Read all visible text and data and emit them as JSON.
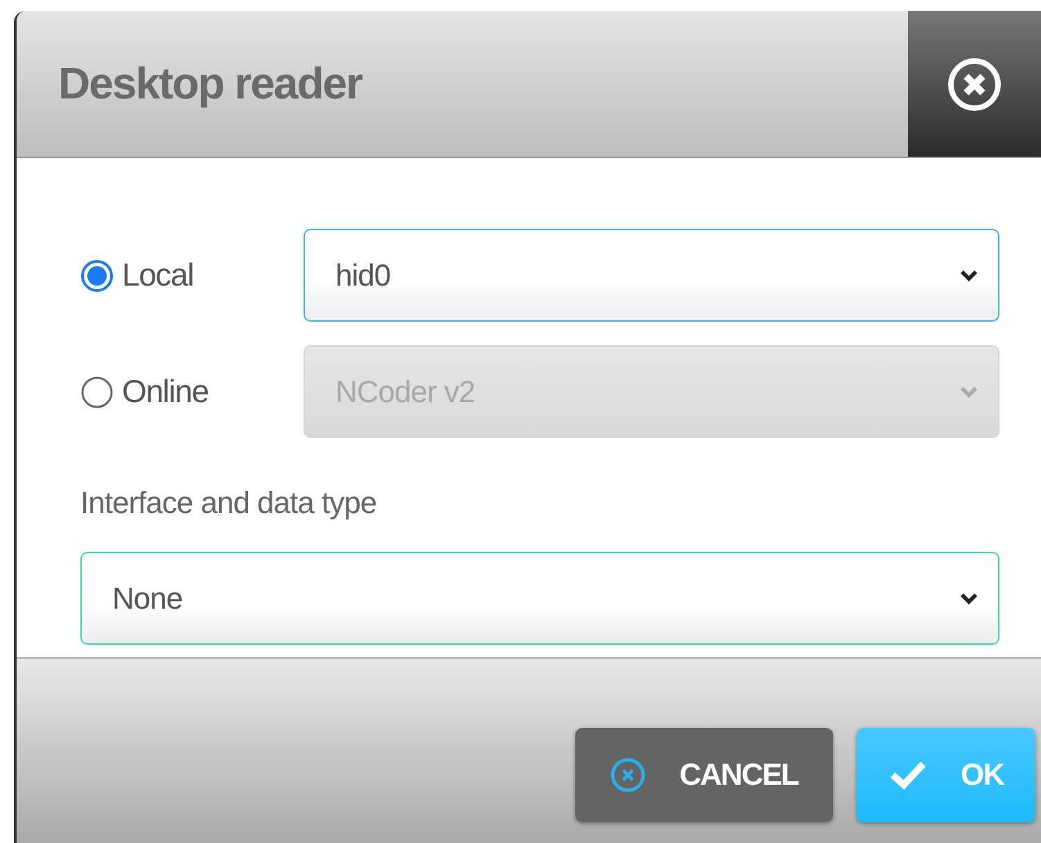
{
  "dialog": {
    "title": "Desktop reader"
  },
  "sources": [
    {
      "label": "Local",
      "selected": true,
      "value": "hid0",
      "disabled": false
    },
    {
      "label": "Online",
      "selected": false,
      "value": "NCoder v2",
      "disabled": true
    }
  ],
  "interface": {
    "label": "Interface and data type",
    "value": "None"
  },
  "buttons": [
    {
      "kind": "cancel",
      "label": "CANCEL"
    },
    {
      "kind": "ok",
      "label": "OK"
    }
  ]
}
